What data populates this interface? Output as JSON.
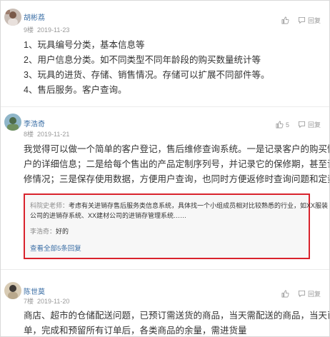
{
  "comments": [
    {
      "user": "胡彬荔",
      "floor": "9楼",
      "date": "2019-11-23",
      "reply_label": "回复",
      "lines": [
        "1、玩具编号分类，基本信息等",
        "2、用户信息分类。如不同类型不同年龄段的购买数量统计等",
        "3、玩具的进货、存储、销售情况。存储可以扩展不同部件等。",
        "4、售后服务。客户查询。"
      ]
    },
    {
      "user": "李浩奇",
      "floor": "8楼",
      "date": "2019-11-21",
      "like_count": "5",
      "reply_label": "回复",
      "lines": [
        "我觉得可以做一个简单的客户登记，售后维修查询系统。一是记录客户的购买情况以及客",
        "户的详细信息；二是给每个售出的产品定制序列号，并记录它的保修期，甚至记录它的维",
        "修情况；三是保存使用数据，方便用户查询，也同时方便返修时查询问题和定责。"
      ],
      "replies": {
        "teacher_tag": "科院史老师：",
        "teacher_line1": "考虑有关进销存售后服务类信息系统，具体找一个小组成员相对比较熟悉的行业，如XX服装",
        "teacher_line2": "公司的进销存系统、XX建材公司的进销存管理系统……",
        "student_tag": "李浩奇：",
        "student_text": "好的",
        "more_link": "查看全部5条回复"
      }
    },
    {
      "user": "陈世莫",
      "floor": "7楼",
      "date": "2019-11-20",
      "reply_label": "回复",
      "lines": [
        "商店、超市的仓储配送问题，已预订需送货的商品，当天需配送的商品，当天已完成的订",
        "单，完成和预留所有订单后，各类商品的余量，需进货量"
      ]
    }
  ],
  "colors": {
    "link": "#3a6ea5",
    "highlight_border": "#d9232d"
  }
}
